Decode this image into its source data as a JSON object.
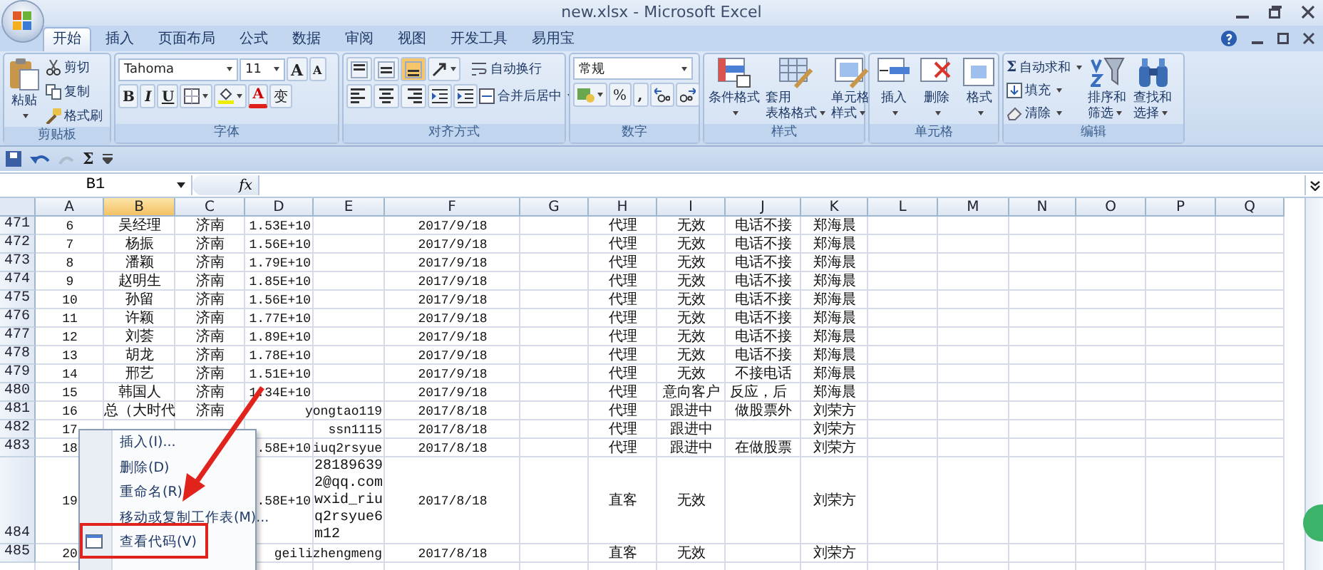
{
  "window": {
    "title": "new.xlsx - Microsoft Excel"
  },
  "tabs": [
    {
      "label": "开始",
      "selected": true
    },
    {
      "label": "插入",
      "selected": false
    },
    {
      "label": "页面布局",
      "selected": false
    },
    {
      "label": "公式",
      "selected": false
    },
    {
      "label": "数据",
      "selected": false
    },
    {
      "label": "审阅",
      "selected": false
    },
    {
      "label": "视图",
      "selected": false
    },
    {
      "label": "开发工具",
      "selected": false
    },
    {
      "label": "易用宝",
      "selected": false
    }
  ],
  "ribbon": {
    "clipboard": {
      "label": "剪贴板",
      "paste": "粘贴",
      "cut": "剪切",
      "copy": "复制",
      "painter": "格式刷"
    },
    "font": {
      "label": "字体",
      "name": "Tahoma",
      "size": "11",
      "grow": "A",
      "shrink": "A",
      "bold": "B",
      "italic": "I",
      "underline": "U",
      "color_button": "A",
      "phonetic": "变"
    },
    "alignment": {
      "label": "对齐方式",
      "wrap": "自动换行",
      "merge": "合并后居中"
    },
    "number": {
      "label": "数字",
      "format": "常规",
      "percent": "%",
      "comma": ","
    },
    "styles": {
      "label": "样式",
      "conditional": [
        "条件格式"
      ],
      "table": [
        "套用",
        "表格格式"
      ],
      "cell": [
        "单元格",
        "样式"
      ]
    },
    "cells": {
      "label": "单元格",
      "insert": "插入",
      "delete": "删除",
      "format": "格式"
    },
    "editing": {
      "label": "编辑",
      "sum_sign": "Σ",
      "autosum": "自动求和",
      "fill": "填充",
      "clear": "清除",
      "sort": [
        "排序和",
        "筛选"
      ],
      "find": [
        "查找和",
        "选择"
      ]
    }
  },
  "quick_access": {
    "sum_sign": "Σ"
  },
  "formula_bar": {
    "name_box": "B1",
    "fx": "fx"
  },
  "columns": [
    {
      "label": "A",
      "selected": false
    },
    {
      "label": "B",
      "selected": true
    },
    {
      "label": "C",
      "selected": false
    },
    {
      "label": "D",
      "selected": false
    },
    {
      "label": "E",
      "selected": false
    },
    {
      "label": "F",
      "selected": false
    },
    {
      "label": "G",
      "selected": false
    },
    {
      "label": "H",
      "selected": false
    },
    {
      "label": "I",
      "selected": false
    },
    {
      "label": "J",
      "selected": false
    },
    {
      "label": "K",
      "selected": false
    },
    {
      "label": "L",
      "selected": false
    },
    {
      "label": "M",
      "selected": false
    },
    {
      "label": "N",
      "selected": false
    },
    {
      "label": "O",
      "selected": false
    },
    {
      "label": "P",
      "selected": false
    },
    {
      "label": "Q",
      "selected": false
    }
  ],
  "rows": [
    {
      "header": "471",
      "cells": {
        "A": "6",
        "B": "吴经理",
        "C": "济南",
        "D": "1.53E+10",
        "F": "2017/9/18",
        "H": "代理",
        "I": "无效",
        "J": "电话不接",
        "K": "郑海晨"
      }
    },
    {
      "header": "472",
      "cells": {
        "A": "7",
        "B": "杨振",
        "C": "济南",
        "D": "1.56E+10",
        "F": "2017/9/18",
        "H": "代理",
        "I": "无效",
        "J": "电话不接",
        "K": "郑海晨"
      }
    },
    {
      "header": "473",
      "cells": {
        "A": "8",
        "B": "潘颖",
        "C": "济南",
        "D": "1.79E+10",
        "F": "2017/9/18",
        "H": "代理",
        "I": "无效",
        "J": "电话不接",
        "K": "郑海晨"
      }
    },
    {
      "header": "474",
      "cells": {
        "A": "9",
        "B": "赵明生",
        "C": "济南",
        "D": "1.85E+10",
        "F": "2017/9/18",
        "H": "代理",
        "I": "无效",
        "J": "电话不接",
        "K": "郑海晨"
      }
    },
    {
      "header": "475",
      "cells": {
        "A": "10",
        "B": "孙留",
        "C": "济南",
        "D": "1.56E+10",
        "F": "2017/9/18",
        "H": "代理",
        "I": "无效",
        "J": "电话不接",
        "K": "郑海晨"
      }
    },
    {
      "header": "476",
      "cells": {
        "A": "11",
        "B": "许颖",
        "C": "济南",
        "D": "1.77E+10",
        "F": "2017/9/18",
        "H": "代理",
        "I": "无效",
        "J": "电话不接",
        "K": "郑海晨"
      }
    },
    {
      "header": "477",
      "cells": {
        "A": "12",
        "B": "刘荟",
        "C": "济南",
        "D": "1.89E+10",
        "F": "2017/9/18",
        "H": "代理",
        "I": "无效",
        "J": "电话不接",
        "K": "郑海晨"
      }
    },
    {
      "header": "478",
      "cells": {
        "A": "13",
        "B": "胡龙",
        "C": "济南",
        "D": "1.78E+10",
        "F": "2017/9/18",
        "H": "代理",
        "I": "无效",
        "J": "电话不接",
        "K": "郑海晨"
      }
    },
    {
      "header": "479",
      "cells": {
        "A": "14",
        "B": "邢艺",
        "C": "济南",
        "D": "1.51E+10",
        "F": "2017/9/18",
        "H": "代理",
        "I": "无效",
        "J": "不接电话",
        "K": "郑海晨"
      }
    },
    {
      "header": "480",
      "cells": {
        "A": "15",
        "B": "韩国人",
        "C": "济南",
        "D": "1.34E+10",
        "F": "2017/9/18",
        "H": "代理",
        "I": "意向客户",
        "J": "反应，后",
        "K": "郑海晨"
      }
    },
    {
      "header": "481",
      "cells": {
        "A": "16",
        "B": "总（大时代",
        "C": "济南",
        "E": "yongtao119",
        "F": "2017/8/18",
        "H": "代理",
        "I": "跟进中",
        "J": "做股票外",
        "K": "刘荣方"
      }
    },
    {
      "header": "482",
      "cells": {
        "A": "17",
        "E": "ssn1115",
        "F": "2017/8/18",
        "H": "代理",
        "I": "跟进中",
        "K": "刘荣方"
      }
    },
    {
      "header": "483",
      "cells": {
        "A": "18",
        "D": ".58E+10",
        "E": "iuq2rsyue",
        "F": "2017/8/18",
        "H": "代理",
        "I": "跟进中",
        "J": "在做股票",
        "K": "刘荣方"
      }
    },
    {
      "header": "484",
      "cells": {
        "A": "19",
        "D": ".58E+10",
        "E": "281896392@qq.com\nwxid_riuq2rsyue6m12",
        "F": "2017/8/18",
        "H": "直客",
        "I": "无效",
        "K": "刘荣方"
      }
    },
    {
      "header": "485",
      "cells": {
        "A": "20",
        "E": "geilizhengmeng",
        "F": "2017/8/18",
        "H": "直客",
        "I": "无效",
        "K": "刘荣方"
      }
    }
  ],
  "context_menu": {
    "items": [
      {
        "label": "插入(I)...",
        "highlighted": false
      },
      {
        "label": "删除(D)",
        "highlighted": false
      },
      {
        "label": "重命名(R)",
        "highlighted": false
      },
      {
        "label": "移动或复制工作表(M)...",
        "highlighted": false
      },
      {
        "label": "查看代码(V)",
        "highlighted": true
      }
    ]
  }
}
